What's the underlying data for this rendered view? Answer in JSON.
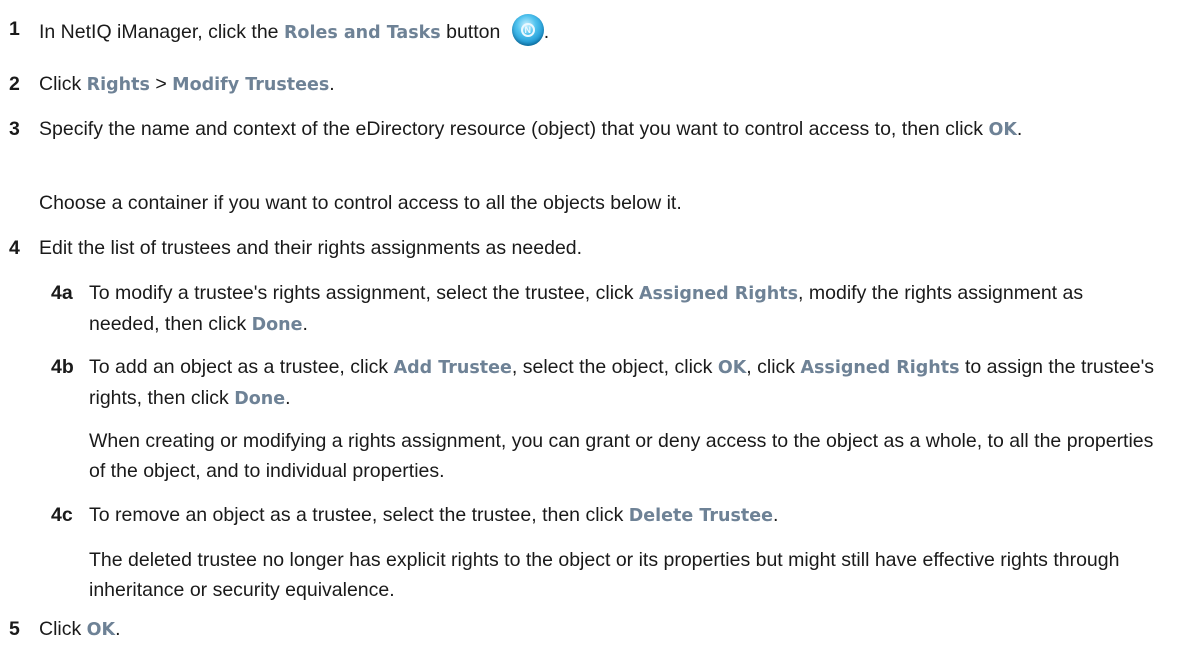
{
  "steps": {
    "s1": {
      "num": "1",
      "t1": "In NetIQ iManager, click the ",
      "ui1": "Roles and Tasks",
      "t2": " button ",
      "t3": "."
    },
    "s2": {
      "num": "2",
      "t1": "Click ",
      "ui1": "Rights",
      "t2": " > ",
      "ui2": "Modify Trustees",
      "t3": "."
    },
    "s3": {
      "num": "3",
      "t1": "Specify the name and context of the eDirectory resource (object) that you want to control access to, then click ",
      "ui1": "OK",
      "t2": ".",
      "note": "Choose a container if you want to control access to all the objects below it."
    },
    "s4": {
      "num": "4",
      "t1": "Edit the list of trustees and their rights assignments as needed."
    },
    "s4a": {
      "num": "4a",
      "t1": "To modify a trustee's rights assignment, select the trustee, click ",
      "ui1": "Assigned Rights",
      "t2": ", modify the rights assignment as needed, then click ",
      "ui2": "Done",
      "t3": "."
    },
    "s4b": {
      "num": "4b",
      "t1": "To add an object as a trustee, click ",
      "ui1": "Add Trustee",
      "t2": ", select the object, click ",
      "ui2": "OK",
      "t3": ", click ",
      "ui3": "Assigned Rights",
      "t4": " to assign the trustee's rights, then click ",
      "ui4": "Done",
      "t5": ".",
      "note": "When creating or modifying a rights assignment, you can grant or deny access to the object as a whole, to all the properties of the object, and to individual properties."
    },
    "s4c": {
      "num": "4c",
      "t1": "To remove an object as a trustee, select the trustee, then click ",
      "ui1": "Delete Trustee",
      "t2": ".",
      "note": "The deleted trustee no longer has explicit rights to the object or its properties but might still have effective rights through inheritance or security equivalence."
    },
    "s5": {
      "num": "5",
      "t1": "Click ",
      "ui1": "OK",
      "t2": "."
    }
  },
  "icons": {
    "roles_tasks": "roles-and-tasks-icon",
    "roles_tasks_glyph": "N"
  },
  "colors": {
    "ui_label": "#6e8296",
    "text": "#1a1a1a",
    "icon_blue": "#1590cf"
  }
}
